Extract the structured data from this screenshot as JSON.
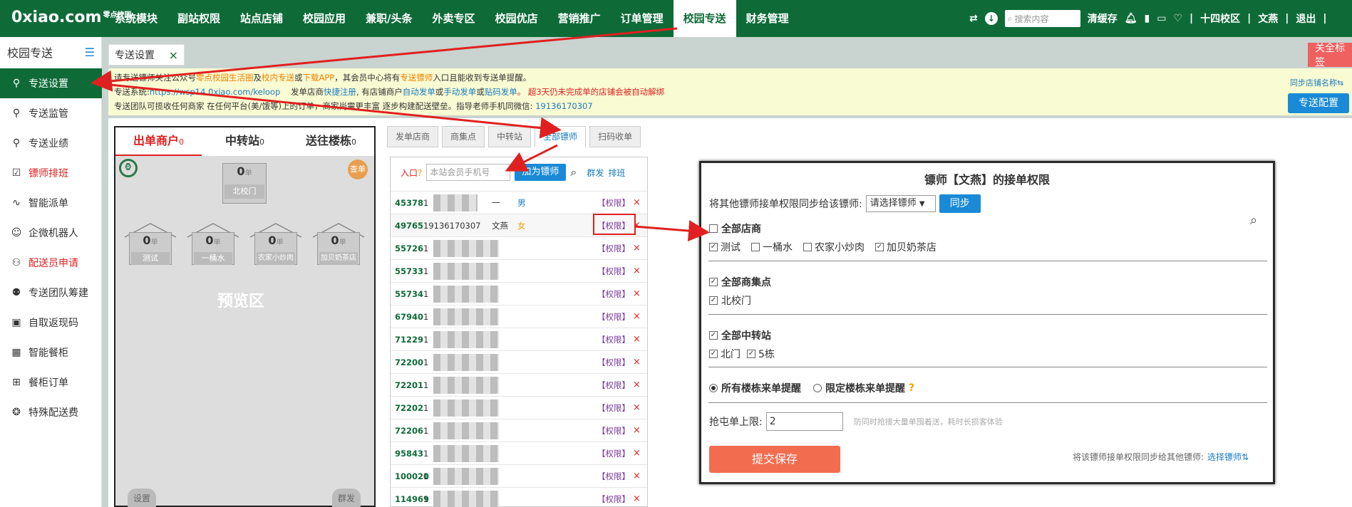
{
  "topbar": {
    "logo": "0xiao.com",
    "logo_small": "零点校园",
    "nav": [
      "系统模块",
      "副站权限",
      "站点店铺",
      "校园应用",
      "兼职/头条",
      "外卖专区",
      "校园优店",
      "营销推广",
      "订单管理",
      "校园专送",
      "财务管理"
    ],
    "active_nav_index": 9,
    "search_placeholder": "搜索内容",
    "clear_cache": "清缓存",
    "campus": "十四校区",
    "user": "文燕",
    "logout": "退出"
  },
  "sidebar": {
    "title": "校园专送",
    "items": [
      {
        "label": "专送设置",
        "icon": "scooter-icon",
        "active": true
      },
      {
        "label": "专送监管",
        "icon": "scooter-icon"
      },
      {
        "label": "专送业绩",
        "icon": "scooter-icon"
      },
      {
        "label": "镖师排班",
        "icon": "schedule-icon",
        "red": true
      },
      {
        "label": "智能派单",
        "icon": "route-icon"
      },
      {
        "label": "企微机器人",
        "icon": "robot-icon"
      },
      {
        "label": "配送员申请",
        "icon": "user-plus-icon",
        "red": true
      },
      {
        "label": "专送团队筹建",
        "icon": "team-icon"
      },
      {
        "label": "自取返现码",
        "icon": "qrcode-icon"
      },
      {
        "label": "智能餐柜",
        "icon": "cabinet-icon"
      },
      {
        "label": "餐柜订单",
        "icon": "grid-icon"
      },
      {
        "label": "特殊配送费",
        "icon": "fee-icon"
      }
    ]
  },
  "tab": {
    "label": "专送设置",
    "close": "×"
  },
  "close_all": "关全标签",
  "notice": {
    "line1_a": "请专送镖师关注公众号",
    "line1_b": "零点校园生活圈",
    "line1_c": "及",
    "line1_d": "校内专送",
    "line1_e": "或",
    "line1_f": "下载APP",
    "line1_g": "，其会员中心将有",
    "line1_h": "专送镖师",
    "line1_i": "入口且能收到专送单提醒。",
    "line2_a": "专送系统:",
    "line2_b": "https://wsp14.0xiao.com/keloop",
    "line2_c": "发单店商",
    "line2_d": "快捷注册",
    "line2_e": ", 有店铺商户",
    "line2_f": "自动发单",
    "line2_g": "或",
    "line2_h": "手动发单",
    "line2_i": "或",
    "line2_j": "贴码发单",
    "line2_k": "。 超3天仍未完成单的店铺会被自动解绑",
    "line3_a": "专送团队可揽收任何商家 在任何平台(美/饿等)上的订单，商家尚需更丰富 逐步构建配送壁垒。指导老师手机同微信:",
    "line3_b": "19136170307",
    "sync_name": "同步店铺名称⇆",
    "config_btn": "专送配置"
  },
  "phone": {
    "tabs": [
      {
        "label": "出单商户",
        "count": "0"
      },
      {
        "label": "中转站",
        "count": "0"
      },
      {
        "label": "送往楼栋",
        "count": "0"
      }
    ],
    "chadan": "查单",
    "top_box": {
      "count": "0",
      "unit": "单",
      "label": "北校门"
    },
    "houses": [
      {
        "count": "0",
        "unit": "单",
        "label": "测试"
      },
      {
        "count": "0",
        "unit": "单",
        "label": "一桶水"
      },
      {
        "count": "0",
        "unit": "单",
        "label": "农家小炒肉"
      },
      {
        "count": "0",
        "unit": "单",
        "label": "加贝奶茶店"
      }
    ],
    "preview": "预览区",
    "btn_left": "设置",
    "btn_right": "群发"
  },
  "subtabs": [
    "发单店商",
    "商集点",
    "中转站",
    "全部镖师",
    "扫码收单"
  ],
  "active_subtab": 3,
  "list": {
    "entry_label": "入口",
    "search_placeholder": "本站会员手机号",
    "add_btn": "加为镖师",
    "group_send": "群发",
    "schedule": "排班",
    "rows": [
      {
        "id": "45378",
        "phone": "1",
        "name": "一",
        "sex": "男"
      },
      {
        "id": "49765",
        "phone": "19136170307",
        "name": "文燕",
        "sex": "女"
      },
      {
        "id": "55726",
        "phone": "1",
        "name": "",
        "sex": ""
      },
      {
        "id": "55733",
        "phone": "1",
        "name": "",
        "sex": ""
      },
      {
        "id": "55734",
        "phone": "1",
        "name": "",
        "sex": ""
      },
      {
        "id": "67940",
        "phone": "1",
        "name": "",
        "sex": ""
      },
      {
        "id": "71229",
        "phone": "1",
        "name": "",
        "sex": ""
      },
      {
        "id": "72200",
        "phone": "1",
        "name": "",
        "sex": ""
      },
      {
        "id": "72201",
        "phone": "1",
        "name": "",
        "sex": ""
      },
      {
        "id": "72202",
        "phone": "1",
        "name": "",
        "sex": ""
      },
      {
        "id": "72206",
        "phone": "1",
        "name": "",
        "sex": ""
      },
      {
        "id": "95843",
        "phone": "1",
        "name": "",
        "sex": ""
      },
      {
        "id": "100020",
        "phone": "1",
        "name": "",
        "sex": ""
      },
      {
        "id": "114969",
        "phone": "1",
        "name": "",
        "sex": ""
      }
    ],
    "perm": "【权限】",
    "del": "×"
  },
  "modal": {
    "title": "镖师【文燕】的接单权限",
    "sync_label": "将其他镖师接单权限同步给该镖师:",
    "sync_select": "请选择镖师",
    "sync_btn": "同步",
    "all_shops": "全部店商",
    "shops": [
      {
        "label": "测试",
        "checked": true
      },
      {
        "label": "一桶水",
        "checked": false
      },
      {
        "label": "农家小炒肉",
        "checked": false
      },
      {
        "label": "加贝奶茶店",
        "checked": true
      }
    ],
    "all_points": "全部商集点",
    "points": [
      {
        "label": "北校门",
        "checked": true
      }
    ],
    "all_transit": "全部中转站",
    "transit": [
      {
        "label": "北门",
        "checked": true
      },
      {
        "label": "5栋",
        "checked": true
      }
    ],
    "radio_all": "所有楼栋来单提醒",
    "radio_limit": "限定楼栋来单提醒",
    "grab_label": "抢屯单上限:",
    "grab_value": "2",
    "grab_hint": "防同时抢接大量单囤着送，耗时长损客体验",
    "submit": "提交保存",
    "footer_text": "将该镖师接单权限同步给其他镖师:",
    "footer_link": "选择镖师⇅"
  },
  "colors": {
    "brand": "#0e6b38",
    "accent_red": "#e02020",
    "link_blue": "#1a7bc0",
    "annotation_arrow": "#e02020"
  }
}
